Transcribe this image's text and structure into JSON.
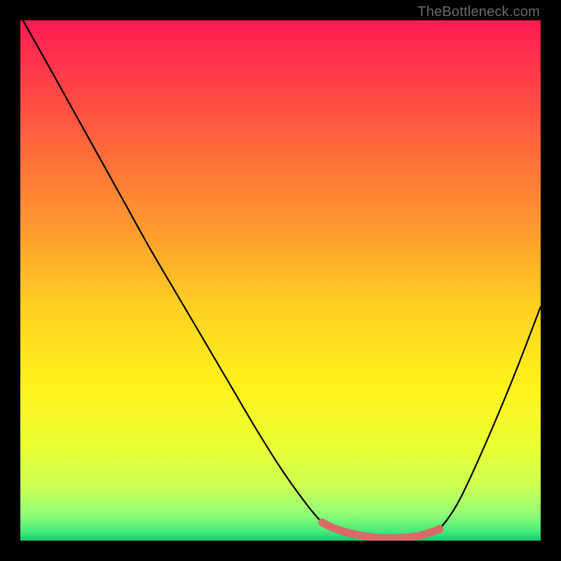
{
  "watermark": "TheBottleneck.com",
  "chart_data": {
    "type": "line",
    "title": "",
    "xlabel": "",
    "ylabel": "",
    "xlim": [
      0,
      100
    ],
    "ylim": [
      0,
      100
    ],
    "background_gradient_stops": [
      {
        "offset": 0.0,
        "color": "#ff1a52"
      },
      {
        "offset": 0.1,
        "color": "#ff3a4a"
      },
      {
        "offset": 0.25,
        "color": "#ff6a3b"
      },
      {
        "offset": 0.4,
        "color": "#ff9a2e"
      },
      {
        "offset": 0.55,
        "color": "#ffd023"
      },
      {
        "offset": 0.7,
        "color": "#fff21a"
      },
      {
        "offset": 0.82,
        "color": "#eaff33"
      },
      {
        "offset": 0.9,
        "color": "#c8ff55"
      },
      {
        "offset": 0.95,
        "color": "#8fff77"
      },
      {
        "offset": 0.985,
        "color": "#3fe87a"
      },
      {
        "offset": 1.0,
        "color": "#14c96b"
      }
    ],
    "series": [
      {
        "name": "bottleneck-curve",
        "color": "#000000",
        "x": [
          0.5,
          5,
          10,
          15,
          20,
          25,
          30,
          35,
          40,
          45,
          50,
          55,
          58,
          60,
          62,
          65,
          70,
          75,
          78,
          80,
          82,
          85,
          90,
          95,
          100
        ],
        "y": [
          100,
          92,
          83,
          74,
          65,
          56,
          47.5,
          39,
          30.5,
          22,
          14,
          7,
          3.5,
          2,
          1.2,
          0.6,
          0.3,
          0.5,
          1.0,
          2.0,
          4.0,
          9,
          20,
          32,
          45
        ]
      }
    ],
    "markers": {
      "name": "optimal-range",
      "color": "#d96a6a",
      "points_x": [
        58,
        60,
        62,
        64,
        66,
        68,
        70,
        72,
        74,
        76,
        78,
        80
      ],
      "points_y": [
        3.5,
        2.5,
        1.8,
        1.3,
        0.9,
        0.6,
        0.5,
        0.5,
        0.6,
        0.8,
        1.3,
        2.0
      ],
      "big_point": {
        "x": 80.5,
        "y": 2.2,
        "r": 6
      }
    }
  }
}
